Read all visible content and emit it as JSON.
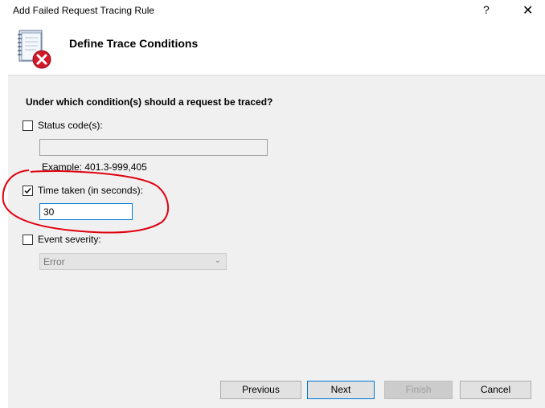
{
  "window": {
    "title": "Add Failed Request Tracing Rule",
    "help_glyph": "?",
    "close_glyph": "✕"
  },
  "header": {
    "title": "Define Trace Conditions",
    "icon": "notebook-error-icon"
  },
  "form": {
    "question": "Under which condition(s) should a request be traced?",
    "status_code": {
      "label": "Status code(s):",
      "checked": false,
      "value": "",
      "example": "Example: 401.3-999,405"
    },
    "time_taken": {
      "label": "Time taken (in seconds):",
      "checked": true,
      "value": "30"
    },
    "event_severity": {
      "label": "Event severity:",
      "checked": false,
      "selected": "Error"
    }
  },
  "buttons": {
    "previous": "Previous",
    "next": "Next",
    "finish": "Finish",
    "cancel": "Cancel"
  },
  "colors": {
    "accent": "#0078d7",
    "annotation": "#e0000f",
    "panel_bg": "#f0f0f0"
  }
}
